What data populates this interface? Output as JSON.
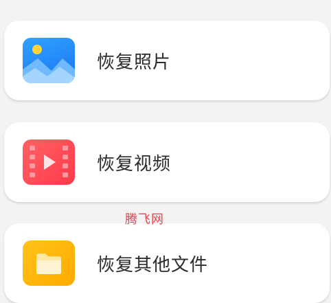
{
  "items": [
    {
      "label": "恢复照片",
      "icon": "photo-icon",
      "color": "#1b73f0"
    },
    {
      "label": "恢复视频",
      "icon": "video-icon",
      "color": "#ff3a4a"
    },
    {
      "label": "恢复其他文件",
      "icon": "folder-icon",
      "color": "#ffab00"
    }
  ],
  "watermark": "腾飞网"
}
